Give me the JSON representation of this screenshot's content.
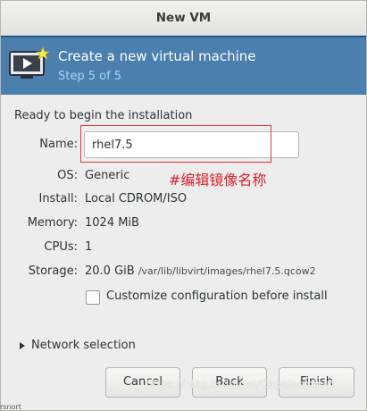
{
  "window": {
    "title": "New VM"
  },
  "banner": {
    "title": "Create a new virtual machine",
    "step": "Step 5 of 5",
    "icon": "monitor-play-icon"
  },
  "section_title": "Ready to begin the installation",
  "form": {
    "name_label": "Name:",
    "name_value": "rhel7.5",
    "os_label": "OS:",
    "os_value": "Generic",
    "install_label": "Install:",
    "install_value": "Local CDROM/ISO",
    "memory_label": "Memory:",
    "memory_value": "1024 MiB",
    "cpus_label": "CPUs:",
    "cpus_value": "1",
    "storage_label": "Storage:",
    "storage_size": "20.0 GiB",
    "storage_path": "/var/lib/libvirt/images/rhel7.5.qcow2",
    "customize_label": "Customize configuration before install",
    "customize_checked": false
  },
  "annotation": "#编辑镜像名称",
  "network": {
    "label": "Network selection"
  },
  "buttons": {
    "cancel": "Cancel",
    "back": "Back",
    "finish": "Finish"
  },
  "watermark": "https://blog.csdn.net/CapeJasmineY",
  "bottom_fragment": "rsnort",
  "colors": {
    "banner_bg": "#4a7fae",
    "banner_step": "#a9d3f2",
    "annotation": "#e0212c"
  }
}
